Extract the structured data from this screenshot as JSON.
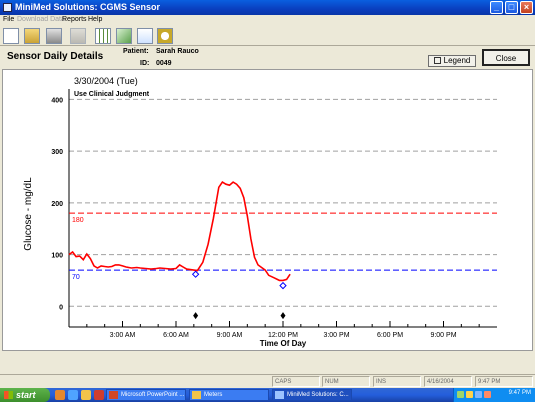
{
  "window": {
    "title": "MiniMed Solutions: CGMS Sensor",
    "controls": [
      "_",
      "□",
      "×"
    ]
  },
  "menu": [
    {
      "label": "File",
      "enabled": true
    },
    {
      "label": "Download Data",
      "enabled": false
    },
    {
      "label": "Reports",
      "enabled": true
    },
    {
      "label": "Help",
      "enabled": true
    }
  ],
  "toolbar": {
    "icons": [
      "new-document-icon",
      "open-folder-icon",
      "print-icon",
      "disk-icon",
      "grid-report-icon",
      "chart-report-icon",
      "line-graph-icon",
      "clock-icon"
    ]
  },
  "header": {
    "section_title": "Sensor Daily Details",
    "patient_label": "Patient:",
    "patient_name": "Sarah Rauco",
    "id_label": "ID:",
    "patient_id": "0049",
    "legend_button": "Legend",
    "close_button": "Close"
  },
  "chart_data": {
    "type": "line",
    "title": "3/30/2004 (Tue)",
    "subtitle": "Use Clinical Judgment",
    "xlabel": "Time Of Day",
    "ylabel": "Glucose - mg/dL",
    "xlim": [
      0,
      24
    ],
    "ylim": [
      -40,
      420
    ],
    "yticks": [
      0,
      100,
      200,
      300,
      400
    ],
    "xticks": [
      {
        "h": 3,
        "label": "3:00 AM"
      },
      {
        "h": 6,
        "label": "6:00 AM"
      },
      {
        "h": 9,
        "label": "9:00 AM"
      },
      {
        "h": 12,
        "label": "12:00 PM"
      },
      {
        "h": 15,
        "label": "3:00 PM"
      },
      {
        "h": 18,
        "label": "6:00 PM"
      },
      {
        "h": 21,
        "label": "9:00 PM"
      }
    ],
    "grid": true,
    "high_limit": {
      "value": 180,
      "label": "180",
      "color": "#ff0000"
    },
    "low_limit": {
      "value": 70,
      "label": "70",
      "color": "#0000ff"
    },
    "series": [
      {
        "color": "#ff0000",
        "points": [
          [
            0.0,
            100
          ],
          [
            0.2,
            105
          ],
          [
            0.4,
            96
          ],
          [
            0.6,
            97
          ],
          [
            0.8,
            90
          ],
          [
            1.0,
            101
          ],
          [
            1.2,
            92
          ],
          [
            1.4,
            78
          ],
          [
            1.6,
            74
          ],
          [
            1.8,
            78
          ],
          [
            2.0,
            77
          ],
          [
            2.2,
            76
          ],
          [
            2.4,
            77
          ],
          [
            2.6,
            80
          ],
          [
            2.8,
            80
          ],
          [
            3.0,
            78
          ],
          [
            3.2,
            76
          ],
          [
            3.5,
            74
          ],
          [
            3.8,
            75
          ],
          [
            4.0,
            74
          ],
          [
            4.3,
            73
          ],
          [
            4.6,
            72
          ],
          [
            4.9,
            73
          ],
          [
            5.1,
            74
          ],
          [
            5.4,
            73
          ],
          [
            5.7,
            72
          ],
          [
            6.0,
            73
          ],
          [
            6.2,
            80
          ],
          [
            6.4,
            76
          ],
          [
            6.6,
            72
          ],
          [
            6.8,
            71
          ],
          [
            7.0,
            70
          ],
          [
            7.2,
            69
          ],
          [
            7.5,
            85
          ],
          [
            7.8,
            120
          ],
          [
            8.1,
            170
          ],
          [
            8.4,
            230
          ],
          [
            8.6,
            240
          ],
          [
            8.8,
            236
          ],
          [
            9.0,
            234
          ],
          [
            9.2,
            240
          ],
          [
            9.4,
            236
          ],
          [
            9.6,
            228
          ],
          [
            9.8,
            210
          ],
          [
            10.0,
            175
          ],
          [
            10.2,
            130
          ],
          [
            10.4,
            95
          ],
          [
            10.6,
            80
          ],
          [
            10.8,
            75
          ],
          [
            11.0,
            70
          ],
          [
            11.2,
            60
          ],
          [
            11.5,
            55
          ],
          [
            11.8,
            50
          ],
          [
            12.0,
            50
          ],
          [
            12.2,
            52
          ],
          [
            12.4,
            62
          ]
        ]
      }
    ],
    "meter_readings": [
      {
        "h": 7.1,
        "value": 62,
        "color": "#0000ff"
      },
      {
        "h": 12.0,
        "value": 40,
        "color": "#0000ff"
      }
    ],
    "events": [
      {
        "h": 7.1,
        "value": -18
      },
      {
        "h": 12.0,
        "value": -18
      }
    ]
  },
  "status": {
    "caps": "CAPS",
    "num": "NUM",
    "ins": "INS",
    "date": "4/16/2004",
    "time": "9:47 PM"
  },
  "taskbar": {
    "start_label": "start",
    "tasks": [
      {
        "label": "Microsoft PowerPoint ...",
        "active": false
      },
      {
        "label": "Meters",
        "active": false
      },
      {
        "label": "MiniMed Solutions: C...",
        "active": true
      }
    ],
    "clock": "9:47 PM"
  },
  "colors": {
    "titlebar": "#0a4ed0",
    "grid": "#a0a0a0",
    "glucose_line": "#ff0000"
  }
}
